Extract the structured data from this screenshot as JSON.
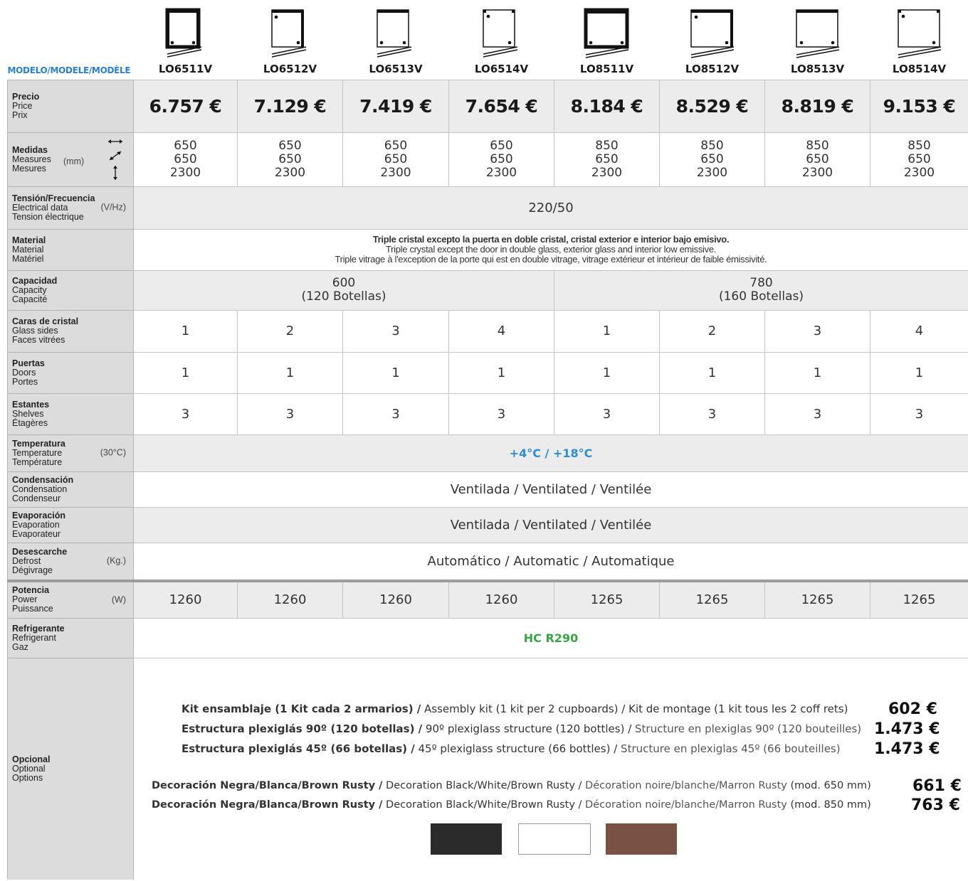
{
  "header": {
    "modelo_label": "MODELO/MODELE/MODÈLE"
  },
  "models": [
    "LO6511V",
    "LO6512V",
    "LO6513V",
    "LO6514V",
    "LO8511V",
    "LO8512V",
    "LO8513V",
    "LO8514V"
  ],
  "icons": [
    "cabinet-1-glass-icon",
    "cabinet-2-glass-icon",
    "cabinet-3-glass-icon",
    "cabinet-4-glass-icon",
    "cabinet-1-glass-icon",
    "cabinet-2-glass-icon",
    "cabinet-3-glass-icon",
    "cabinet-4-glass-icon"
  ],
  "rows": {
    "precio": {
      "l1": "Precio",
      "l2": "Price",
      "l3": "Prix",
      "values": [
        "6.757 €",
        "7.129 €",
        "7.419 €",
        "7.654 €",
        "8.184 €",
        "8.529 €",
        "8.819 €",
        "9.153 €"
      ]
    },
    "medidas": {
      "l1": "Medidas",
      "l2": "Measures",
      "l3": "Mesures",
      "unit": "(mm)",
      "values": [
        [
          "650",
          "650",
          "2300"
        ],
        [
          "650",
          "650",
          "2300"
        ],
        [
          "650",
          "650",
          "2300"
        ],
        [
          "650",
          "650",
          "2300"
        ],
        [
          "850",
          "650",
          "2300"
        ],
        [
          "850",
          "650",
          "2300"
        ],
        [
          "850",
          "650",
          "2300"
        ],
        [
          "850",
          "650",
          "2300"
        ]
      ]
    },
    "tension": {
      "l1": "Tensión/Frecuencia",
      "l2": "Electrical data",
      "l3": "Tension électrique",
      "unit": "(V/Hz)",
      "value": "220/50"
    },
    "material": {
      "l1": "Material",
      "l2": "Material",
      "l3": "Matériel",
      "es": "Triple cristal excepto la puerta en doble cristal, cristal exterior e interior bajo emisivo.",
      "en": "Triple crystal except the door in double glass, exterior glass and interior low emissive.",
      "fr": "Triple vitrage à l'exception de la porte qui est en double vitrage, vitrage extérieur et intérieur de faible émissivité."
    },
    "capacidad": {
      "l1": "Capacidad",
      "l2": "Capacity",
      "l3": "Capacité",
      "groups": [
        {
          "line1": "600",
          "line2": "(120 Botellas)"
        },
        {
          "line1": "780",
          "line2": "(160 Botellas)"
        }
      ]
    },
    "caras": {
      "l1": "Caras de cristal",
      "l2": "Glass sides",
      "l3": "Faces vitrées",
      "values": [
        "1",
        "2",
        "3",
        "4",
        "1",
        "2",
        "3",
        "4"
      ]
    },
    "puertas": {
      "l1": "Puertas",
      "l2": "Doors",
      "l3": "Portes",
      "values": [
        "1",
        "1",
        "1",
        "1",
        "1",
        "1",
        "1",
        "1"
      ]
    },
    "estantes": {
      "l1": "Estantes",
      "l2": "Shelves",
      "l3": "Étagères",
      "values": [
        "3",
        "3",
        "3",
        "3",
        "3",
        "3",
        "3",
        "3"
      ]
    },
    "temperatura": {
      "l1": "Temperatura",
      "l2": "Temperature",
      "l3": "Température",
      "unit": "(30°C)",
      "value": "+4°C / +18°C"
    },
    "condensacion": {
      "l1": "Condensación",
      "l2": "Condensation",
      "l3": "Condenseur",
      "value": "Ventilada / Ventilated / Ventilée"
    },
    "evaporacion": {
      "l1": "Evaporación",
      "l2": "Evaporation",
      "l3": "Evaporateur",
      "value": "Ventilada / Ventilated / Ventilée"
    },
    "desescarche": {
      "l1": "Desescarche",
      "l2": "Defrost",
      "l3": "Dégivrage",
      "unit": "(Kg.)",
      "value": "Automático / Automatic / Automatique"
    },
    "potencia": {
      "l1": "Potencia",
      "l2": "Power",
      "l3": "Puissance",
      "unit": "(W)",
      "values": [
        "1260",
        "1260",
        "1260",
        "1260",
        "1265",
        "1265",
        "1265",
        "1265"
      ]
    },
    "refrigerante": {
      "l1": "Refrigerante",
      "l2": "Refrigerant",
      "l3": "Gaz",
      "value": "HC R290"
    },
    "opcional": {
      "l1": "Opcional",
      "l2": "Optional",
      "l3": "Options"
    }
  },
  "options": [
    {
      "es": "Kit ensamblaje  (1 Kit cada 2 armarios) /",
      "en": " Assembly kit (1 kit per 2 cupboards) /",
      "fr": " Kit de montage (1 kit tous les 2 coff rets)",
      "price": "602 €"
    },
    {
      "es": "Estructura plexiglás 90º (120 botellas) /",
      "en": " 90º plexiglass structure (120 bottles) /",
      "fr": " Structure en plexiglas 90º (120 bouteilles)",
      "price": "1.473 €"
    },
    {
      "es": "Estructura plexiglás 45º (66 botellas) /",
      "en": " 45º plexiglass structure (66 bottles) /",
      "fr": " Structure en plexiglas 45º (66 bouteilles)",
      "price": "1.473 €"
    }
  ],
  "decorations": [
    {
      "es": "Decoración Negra/Blanca/Brown Rusty /",
      "en": " Decoration Black/White/Brown Rusty /",
      "fr": " Décoration noire/blanche/Marron Rusty",
      "size": "(mod. 650 mm)",
      "price": "661 €"
    },
    {
      "es": "Decoración Negra/Blanca/Brown Rusty /",
      "en": " Decoration Black/White/Brown Rusty /",
      "fr": " Décoration noire/blanche/Marron Rusty",
      "size": "(mod. 850 mm)",
      "price": "763 €"
    }
  ],
  "swatches": [
    {
      "name": "black",
      "color": "#2b2b2b"
    },
    {
      "name": "white",
      "color": "#ffffff"
    },
    {
      "name": "brown-rusty",
      "color": "#7a5243"
    }
  ],
  "colors": {
    "label_bg": "#dcdcdc",
    "grey_row": "#ececec",
    "temp_blue": "#2b8fd6",
    "gas_green": "#3aa345"
  }
}
